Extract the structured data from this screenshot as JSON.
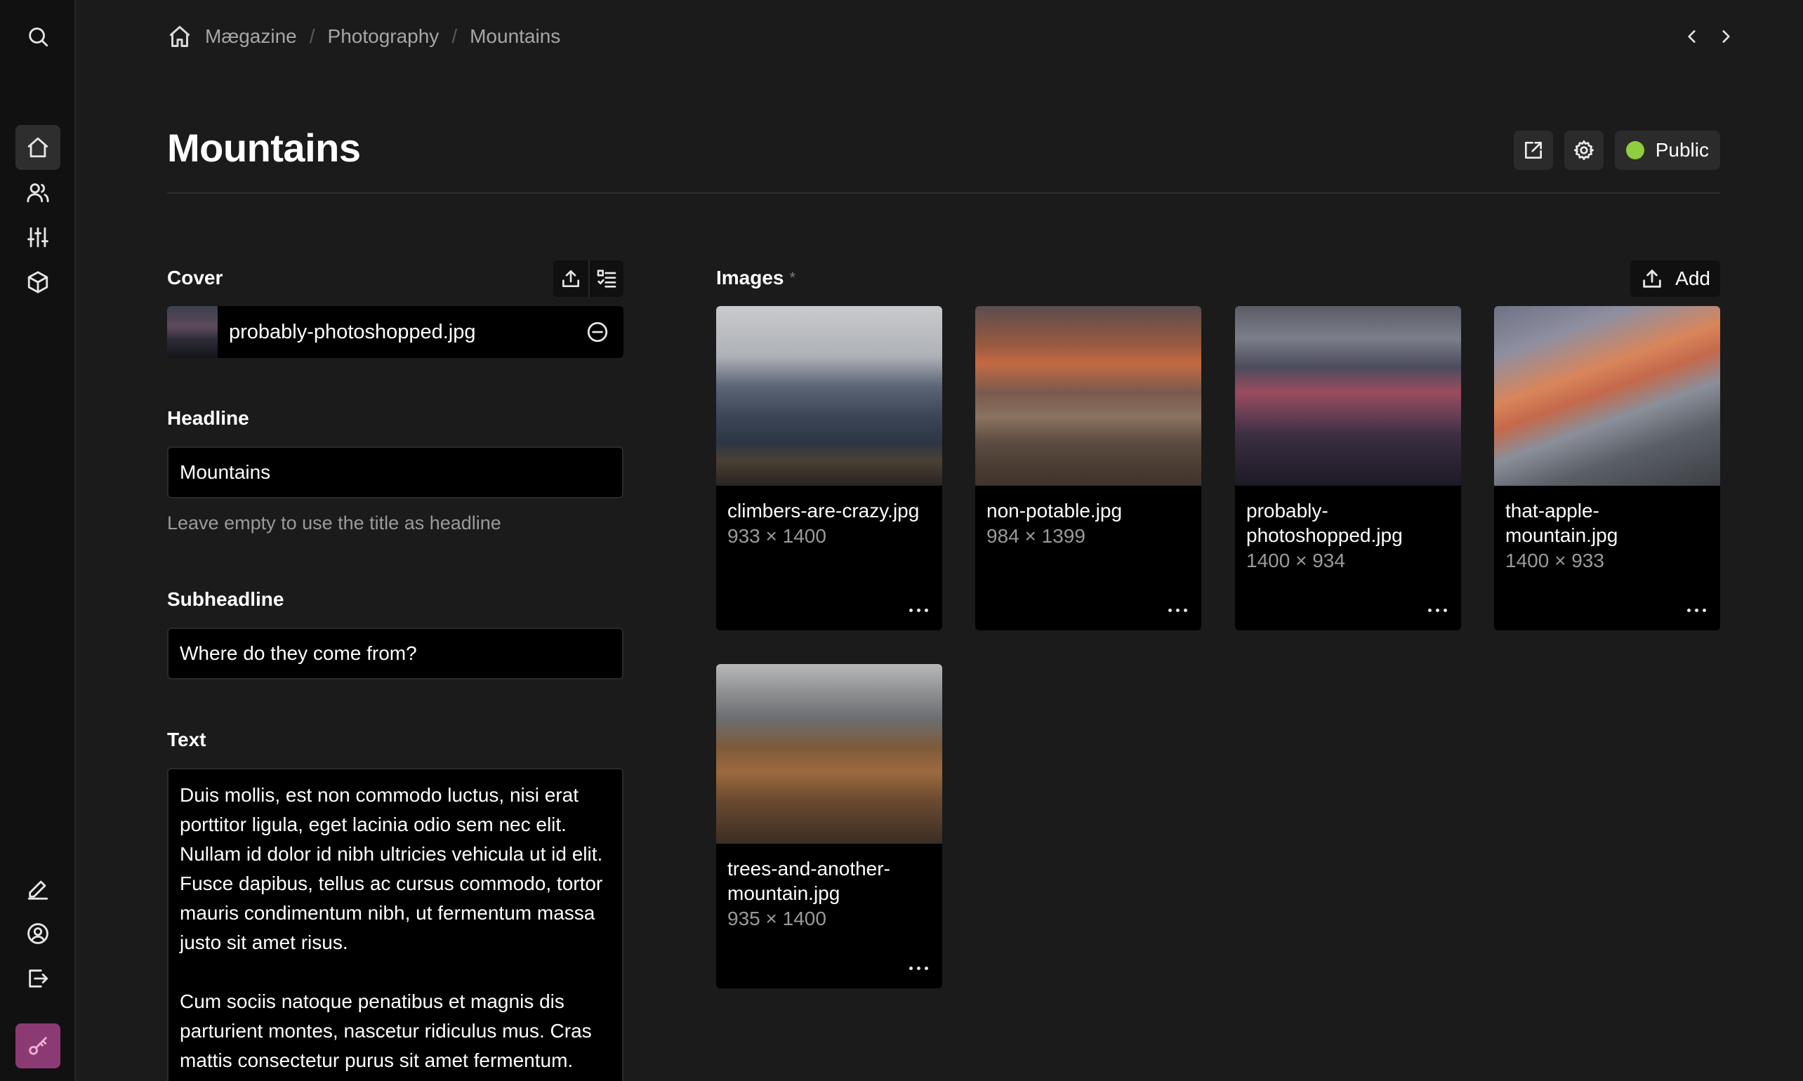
{
  "sidebar": {
    "items": [
      {
        "icon": "search-icon"
      },
      {
        "icon": "home-icon",
        "active": true
      },
      {
        "icon": "users-icon"
      },
      {
        "icon": "sliders-icon"
      },
      {
        "icon": "box-icon"
      },
      {
        "icon": "pen-icon"
      },
      {
        "icon": "account-icon"
      },
      {
        "icon": "logout-icon"
      },
      {
        "icon": "key-icon"
      }
    ],
    "license_color": "#8c3a74"
  },
  "breadcrumb": {
    "items": [
      "Mægazine",
      "Photography",
      "Mountains"
    ],
    "separator": "/"
  },
  "header": {
    "title": "Mountains",
    "status_label": "Public",
    "status_color": "#8fce3f"
  },
  "fields": {
    "cover": {
      "label": "Cover",
      "filename": "probably-photoshopped.jpg"
    },
    "headline": {
      "label": "Headline",
      "value": "Mountains",
      "help": "Leave empty to use the title as headline"
    },
    "subheadline": {
      "label": "Subheadline",
      "value": "Where do they come from?"
    },
    "text": {
      "label": "Text",
      "paragraphs": [
        "Duis mollis, est non commodo luctus, nisi erat porttitor ligula, eget lacinia odio sem nec elit. Nullam id dolor id nibh ultricies vehicula ut id elit. Fusce dapibus, tellus ac cursus commodo, tortor mauris condimentum nibh, ut fermentum massa justo sit amet risus.",
        "Cum sociis natoque penatibus et magnis dis parturient montes, nascetur ridiculus mus. Cras mattis consectetur purus sit amet fermentum."
      ]
    }
  },
  "images": {
    "label": "Images",
    "required_mark": "*",
    "add_label": "Add",
    "files": [
      {
        "name": "climbers-are-crazy.jpg",
        "dims": "933 × 1400"
      },
      {
        "name": "non-potable.jpg",
        "dims": "984 × 1399"
      },
      {
        "name": "probably-photoshopped.jpg",
        "dims": "1400 × 934"
      },
      {
        "name": "that-apple-mountain.jpg",
        "dims": "1400 × 933"
      },
      {
        "name": "trees-and-another-mountain.jpg",
        "dims": "935 × 1400"
      }
    ]
  }
}
